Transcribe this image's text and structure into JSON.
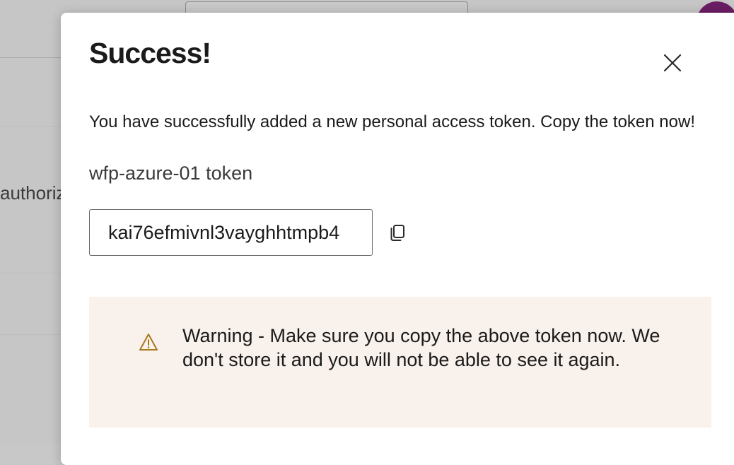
{
  "background": {
    "partial_text": "authoriz"
  },
  "dialog": {
    "title": "Success!",
    "close_icon": "close-icon",
    "description": "You have successfully added a new personal access token. Copy the token now!",
    "token_name": "wfp-azure-01 token",
    "token_value": "kai76efmivnl3vayghhtmpb4",
    "copy_icon": "copy-icon",
    "warning": {
      "icon": "warning-icon",
      "text": "Warning - Make sure you copy the above token now. We don't store it and you will not be able to see it again."
    }
  },
  "colors": {
    "warning_background": "#f9f1ec",
    "warning_icon": "#a67a1e",
    "avatar": "#6b1d63"
  }
}
